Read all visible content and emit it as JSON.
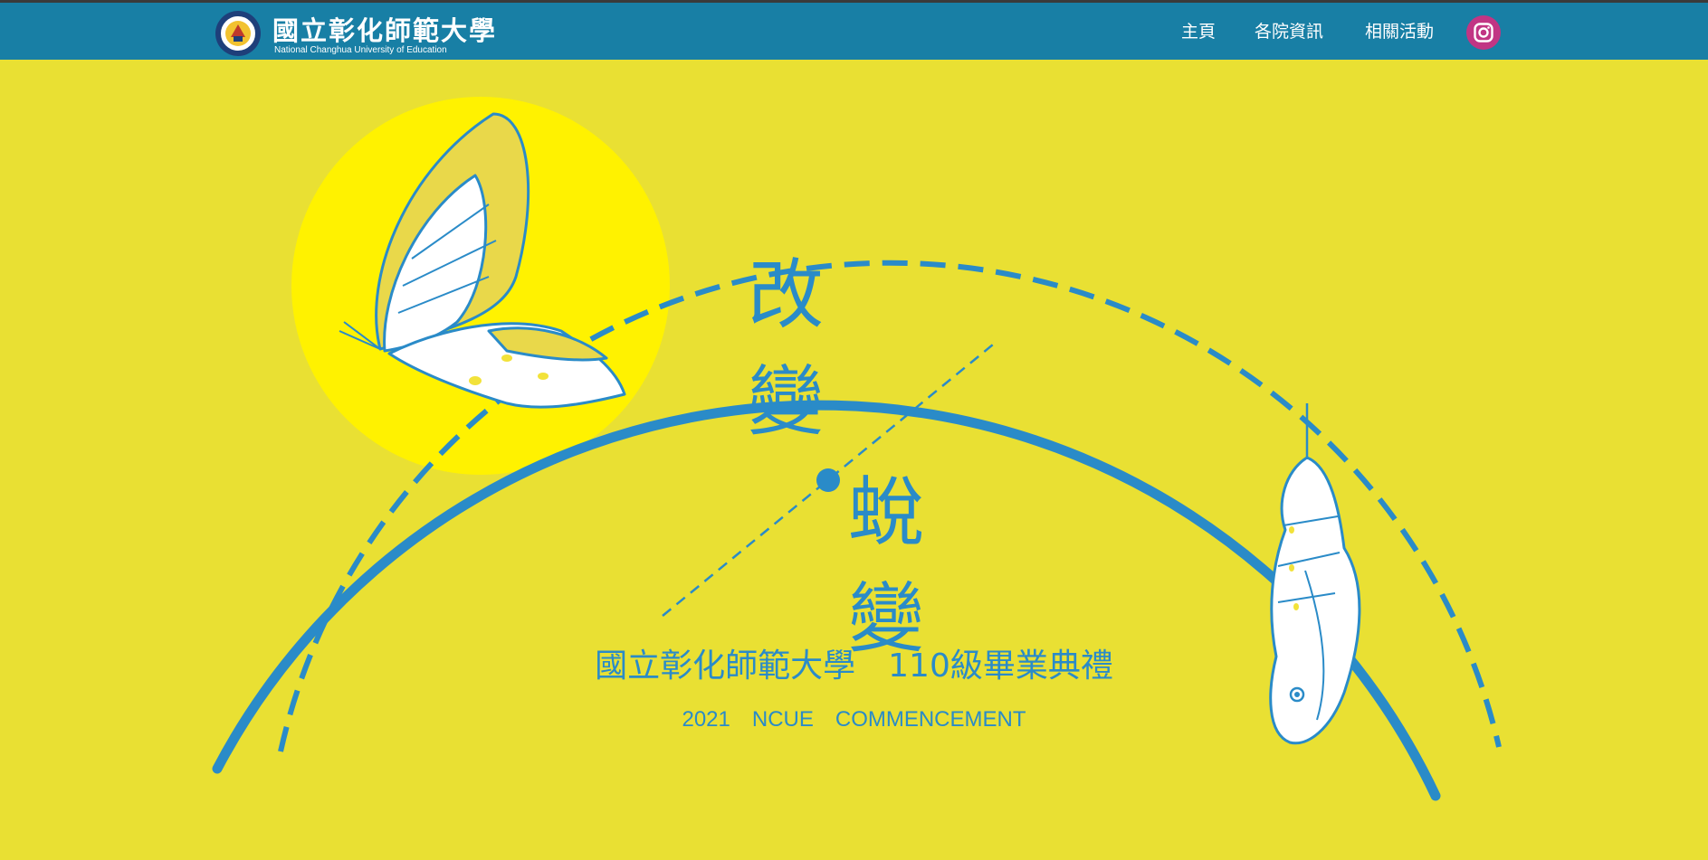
{
  "header": {
    "logo_cn": "國立彰化師範大學",
    "logo_en": "National Changhua University of Education",
    "nav": [
      {
        "label": "主頁"
      },
      {
        "label": "各院資訊"
      },
      {
        "label": "相關活動"
      }
    ],
    "social_icon": "instagram-icon"
  },
  "hero": {
    "title_chars_left": [
      "改",
      "變"
    ],
    "title_chars_right": [
      "蛻",
      "變"
    ],
    "subtitle_cn": "國立彰化師範大學　110級畢業典禮",
    "subtitle_en": "2021　NCUE　COMMENCEMENT"
  },
  "colors": {
    "background": "#e9e033",
    "navbar": "#187fa5",
    "accent_blue": "#2a8bc8",
    "sun": "#fff200",
    "instagram": "#c13584"
  }
}
